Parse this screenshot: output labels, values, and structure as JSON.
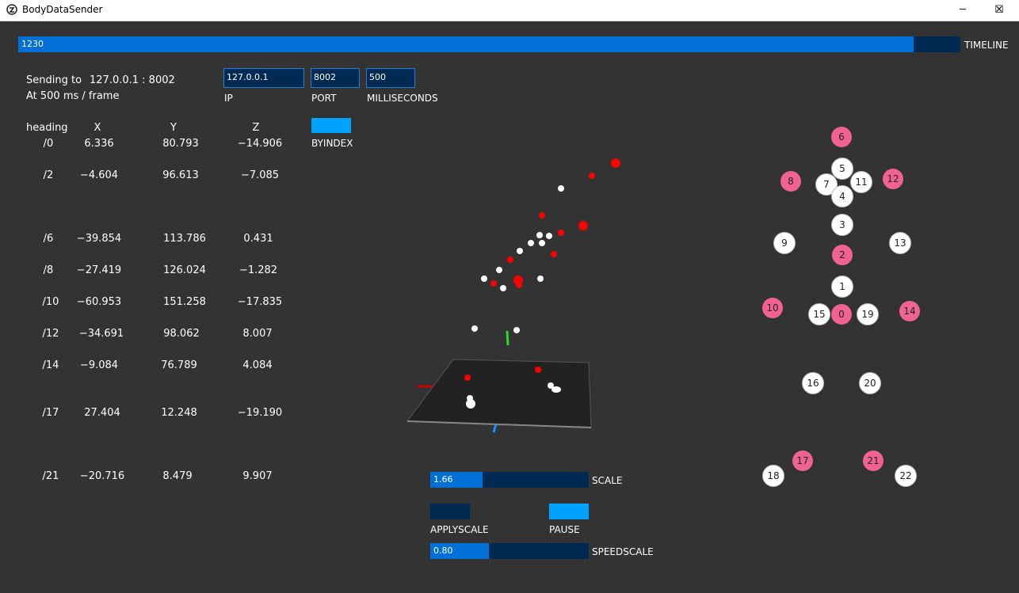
{
  "window": {
    "title": "BodyDataSender",
    "minimize_glyph": "─",
    "maximize_glyph": "☐",
    "close_glyph": "✕"
  },
  "timeline": {
    "value": "1230",
    "label": "TIMELINE",
    "fraction": 0.95
  },
  "status": {
    "sending_prefix": "Sending to",
    "sending_value": "127.0.0.1 : 8002",
    "at_text": "At  500 ms / frame"
  },
  "fields": {
    "ip": {
      "value": "127.0.0.1",
      "label": "IP"
    },
    "port": {
      "value": "8002",
      "label": "PORT"
    },
    "ms": {
      "value": "500",
      "label": "MILLISECONDS"
    }
  },
  "byindex": {
    "label": "BYINDEX"
  },
  "table": {
    "headers": [
      "heading",
      "X",
      "Y",
      "Z"
    ],
    "rows": [
      [
        "/0",
        "6.336",
        "80.793",
        "−14.906"
      ],
      [
        "/2",
        "−4.604",
        "96.613",
        "−7.085"
      ],
      [
        "/6",
        "−39.854",
        "113.786",
        "0.431"
      ],
      [
        "/8",
        "−27.419",
        "126.024",
        "−1.282"
      ],
      [
        "/10",
        "−60.953",
        "151.258",
        "−17.835"
      ],
      [
        "/12",
        "−34.691",
        "98.062",
        "8.007"
      ],
      [
        "/14",
        "−9.084",
        "76.789",
        "4.084"
      ],
      [
        "/17",
        "27.404",
        "12.248",
        "−19.190"
      ],
      [
        "/21",
        "−20.716",
        "8.479",
        "9.907"
      ]
    ]
  },
  "scale": {
    "value": "1.66",
    "label": "SCALE",
    "fraction": 0.33
  },
  "applyscale": {
    "label": "APPLYSCALE"
  },
  "pause": {
    "label": "PAUSE"
  },
  "speedscale": {
    "value": "0.80",
    "label": "SPEEDSCALE",
    "fraction": 0.37
  },
  "joints": [
    {
      "id": "6",
      "state": "selected"
    },
    {
      "id": "5",
      "state": "normal"
    },
    {
      "id": "7",
      "state": "normal"
    },
    {
      "id": "11",
      "state": "normal"
    },
    {
      "id": "8",
      "state": "selected"
    },
    {
      "id": "12",
      "state": "selected"
    },
    {
      "id": "4",
      "state": "normal"
    },
    {
      "id": "3",
      "state": "normal"
    },
    {
      "id": "9",
      "state": "normal"
    },
    {
      "id": "13",
      "state": "normal"
    },
    {
      "id": "2",
      "state": "selected"
    },
    {
      "id": "1",
      "state": "normal"
    },
    {
      "id": "10",
      "state": "selected"
    },
    {
      "id": "15",
      "state": "normal"
    },
    {
      "id": "0",
      "state": "selected"
    },
    {
      "id": "19",
      "state": "normal"
    },
    {
      "id": "14",
      "state": "selected"
    },
    {
      "id": "16",
      "state": "normal"
    },
    {
      "id": "20",
      "state": "normal"
    },
    {
      "id": "17",
      "state": "selected"
    },
    {
      "id": "21",
      "state": "selected"
    },
    {
      "id": "18",
      "state": "normal"
    },
    {
      "id": "22",
      "state": "normal"
    }
  ],
  "colors": {
    "background": "#333333",
    "bar_track": "#002a52",
    "bar_fill": "#0070d6",
    "toggle_on": "#00a2ff",
    "joint_selected": "#f06292",
    "joint_normal": "#ffffff",
    "point_red": "#ff0000",
    "point_white": "#ffffff"
  }
}
